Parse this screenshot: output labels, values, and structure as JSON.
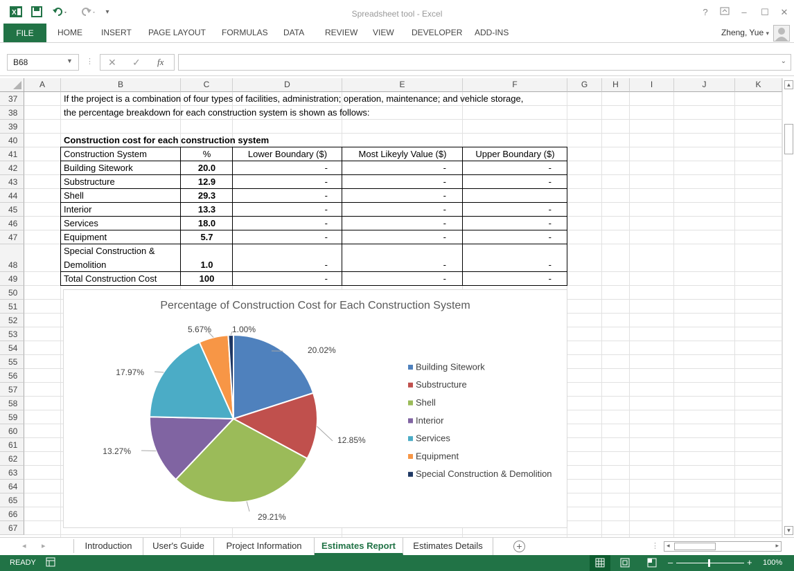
{
  "window": {
    "title": "Spreadsheet tool - Excel"
  },
  "ribbon": {
    "file": "FILE",
    "tabs": [
      "HOME",
      "INSERT",
      "PAGE LAYOUT",
      "FORMULAS",
      "DATA",
      "REVIEW",
      "VIEW",
      "DEVELOPER",
      "ADD-INS"
    ],
    "user": "Zheng, Yue"
  },
  "formula_bar": {
    "name_box": "B68",
    "fx": "fx",
    "formula": ""
  },
  "columns": [
    "A",
    "B",
    "C",
    "D",
    "E",
    "F",
    "G",
    "H",
    "I",
    "J",
    "K"
  ],
  "rows": [
    "37",
    "38",
    "39",
    "40",
    "41",
    "42",
    "43",
    "44",
    "45",
    "46",
    "47",
    "48",
    "49",
    "50",
    "51",
    "52",
    "53",
    "54",
    "55",
    "56",
    "57",
    "58",
    "59",
    "60",
    "61",
    "62",
    "63",
    "64",
    "65",
    "66",
    "67"
  ],
  "sheet": {
    "intro_line1": "If the project is a combination of four types of facilities, administration; operation, maintenance; and vehicle storage,",
    "intro_line2": "the percentage breakdown for each construction system is shown as follows:",
    "table_title": "Construction cost for each construction system",
    "headers": [
      "Construction System",
      "%",
      "Lower Boundary ($)",
      "Most Likeyly Value ($)",
      "Upper Boundary ($)"
    ],
    "table": [
      {
        "name": "Building Sitework",
        "pct": "20.0",
        "lower": "-",
        "likely": "-",
        "upper": "-"
      },
      {
        "name": "Substructure",
        "pct": "12.9",
        "lower": "-",
        "likely": "-",
        "upper": "-"
      },
      {
        "name": "Shell",
        "pct": "29.3",
        "lower": "-",
        "likely": "-",
        "upper": ""
      },
      {
        "name": "Interior",
        "pct": "13.3",
        "lower": "-",
        "likely": "-",
        "upper": "-"
      },
      {
        "name": "Services",
        "pct": "18.0",
        "lower": "-",
        "likely": "-",
        "upper": "-"
      },
      {
        "name": "Equipment",
        "pct": "5.7",
        "lower": "-",
        "likely": "-",
        "upper": "-"
      },
      {
        "name": "Demolition",
        "name_top": "Special Construction &",
        "pct": "1.0",
        "lower": "-",
        "likely": "-",
        "upper": "-"
      },
      {
        "name": "Total Construction Cost",
        "pct": "100",
        "lower": "-",
        "likely": "-",
        "upper": "-"
      }
    ]
  },
  "chart_data": {
    "type": "pie",
    "title": "Percentage of Construction Cost for Each Construction System",
    "categories": [
      "Building Sitework",
      "Substructure",
      "Shell",
      "Interior",
      "Services",
      "Equipment",
      "Special Construction & Demolition"
    ],
    "values": [
      20.02,
      12.85,
      29.21,
      13.27,
      17.97,
      5.67,
      1.0
    ],
    "data_labels": [
      "20.02%",
      "12.85%",
      "29.21%",
      "13.27%",
      "17.97%",
      "5.67%",
      "1.00%"
    ],
    "colors": [
      "#4F81BD",
      "#C0504D",
      "#9BBB59",
      "#8064A2",
      "#4BACC6",
      "#F79646",
      "#1F3864"
    ],
    "legend": "right"
  },
  "sheet_tabs": [
    "Introduction",
    "User's Guide",
    "Project Information",
    "Estimates Report",
    "Estimates Details"
  ],
  "active_sheet": "Estimates Report",
  "status": {
    "mode": "READY",
    "zoom": "100%"
  }
}
